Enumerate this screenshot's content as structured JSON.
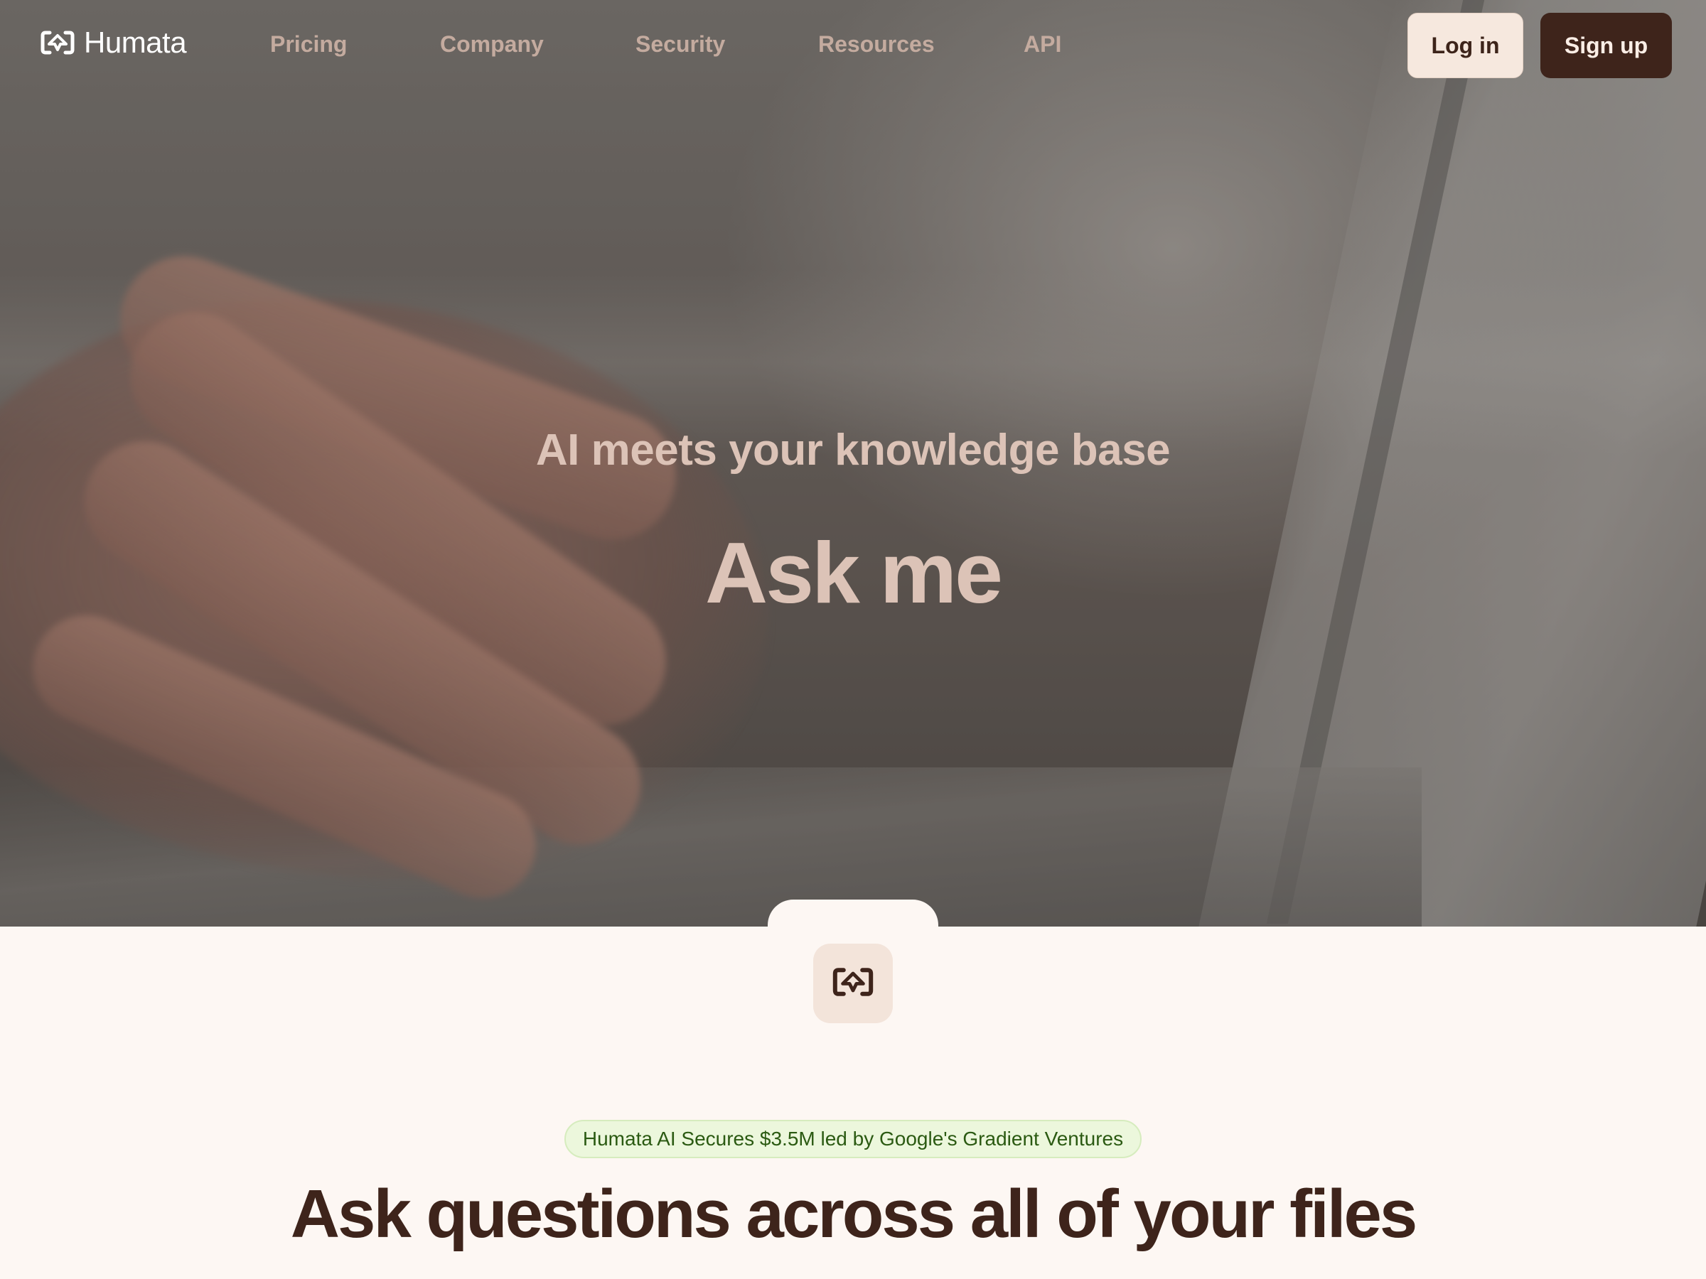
{
  "brand": {
    "name": "Humata"
  },
  "nav": {
    "links": [
      "Pricing",
      "Company",
      "Security",
      "Resources",
      "API"
    ],
    "login_label": "Log in",
    "signup_label": "Sign up"
  },
  "hero": {
    "subtitle": "AI meets your knowledge base",
    "title": "Ask me"
  },
  "section": {
    "badge": "Humata AI Secures $3.5M led by Google's Gradient Ventures",
    "headline": "Ask questions across all of your files"
  },
  "colors": {
    "brand_dark": "#3e241b",
    "brand_light": "#f6e8de",
    "badge_bg": "#ecf7dc",
    "badge_text": "#2b5a12",
    "page_bg": "#fdf7f3"
  },
  "icons": {
    "logo": "humata-logo-icon",
    "tile": "humata-mark-icon"
  }
}
